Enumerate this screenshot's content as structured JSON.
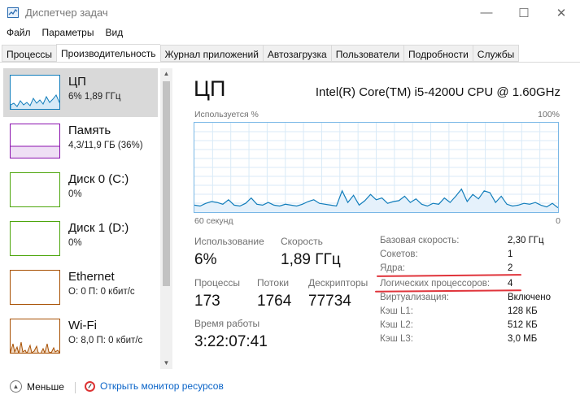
{
  "window": {
    "title": "Диспетчер задач",
    "controls": {
      "minimize": "—",
      "maximize": "☐",
      "close": "✕"
    }
  },
  "menu": [
    "Файл",
    "Параметры",
    "Вид"
  ],
  "tabs": [
    {
      "label": "Процессы",
      "active": false
    },
    {
      "label": "Производительность",
      "active": true
    },
    {
      "label": "Журнал приложений",
      "active": false
    },
    {
      "label": "Автозагрузка",
      "active": false
    },
    {
      "label": "Пользователи",
      "active": false
    },
    {
      "label": "Подробности",
      "active": false
    },
    {
      "label": "Службы",
      "active": false
    }
  ],
  "resources": [
    {
      "name": "ЦП",
      "sub": "6% 1,89 ГГц",
      "color": "#117dbb",
      "selected": true
    },
    {
      "name": "Память",
      "sub": "4,3/11,9 ГБ (36%)",
      "color": "#8b12ae"
    },
    {
      "name": "Диск 0 (C:)",
      "sub": "0%",
      "color": "#4da60c"
    },
    {
      "name": "Диск 1 (D:)",
      "sub": "0%",
      "color": "#4da60c"
    },
    {
      "name": "Ethernet",
      "sub": "О: 0 П: 0 кбит/с",
      "color": "#a74f01"
    },
    {
      "name": "Wi-Fi",
      "sub": "О: 8,0 П: 0 кбит/с",
      "color": "#a74f01"
    }
  ],
  "cpu": {
    "title": "ЦП",
    "model": "Intel(R) Core(TM) i5-4200U CPU @ 1.60GHz",
    "graph_label": "Используется %",
    "graph_max": "100%",
    "graph_time": "60 секунд",
    "graph_min": "0",
    "graph_color": "#117dbb",
    "usage_history": [
      6,
      5,
      8,
      10,
      9,
      7,
      12,
      6,
      5,
      8,
      14,
      7,
      6,
      9,
      6,
      5,
      7,
      6,
      5,
      7,
      10,
      12,
      8,
      7,
      6,
      5,
      22,
      9,
      17,
      6,
      11,
      18,
      12,
      14,
      8,
      10,
      11,
      16,
      9,
      13,
      7,
      5,
      8,
      7,
      14,
      9,
      16,
      24,
      10,
      18,
      13,
      22,
      20,
      9,
      16,
      7,
      5,
      6,
      8,
      7,
      9,
      6,
      4,
      8,
      3
    ],
    "stats": {
      "usage_label": "Использование",
      "usage_value": "6%",
      "speed_label": "Скорость",
      "speed_value": "1,89 ГГц",
      "processes_label": "Процессы",
      "processes_value": "173",
      "threads_label": "Потоки",
      "threads_value": "1764",
      "handles_label": "Дескрипторы",
      "handles_value": "77734",
      "uptime_label": "Время работы",
      "uptime_value": "3:22:07:41"
    },
    "details": [
      {
        "label": "Базовая скорость:",
        "value": "2,30 ГГц"
      },
      {
        "label": "Сокетов:",
        "value": "1"
      },
      {
        "label": "Ядра:",
        "value": "2"
      },
      {
        "label": "Логических процессоров:",
        "value": "4"
      },
      {
        "label": "Виртуализация:",
        "value": "Включено"
      },
      {
        "label": "Кэш L1:",
        "value": "128 КБ"
      },
      {
        "label": "Кэш L2:",
        "value": "512 КБ"
      },
      {
        "label": "Кэш L3:",
        "value": "3,0 МБ"
      }
    ],
    "highlight_color": "#e0343b"
  },
  "footer": {
    "less_label": "Меньше",
    "monitor_label": "Открыть монитор ресурсов"
  }
}
